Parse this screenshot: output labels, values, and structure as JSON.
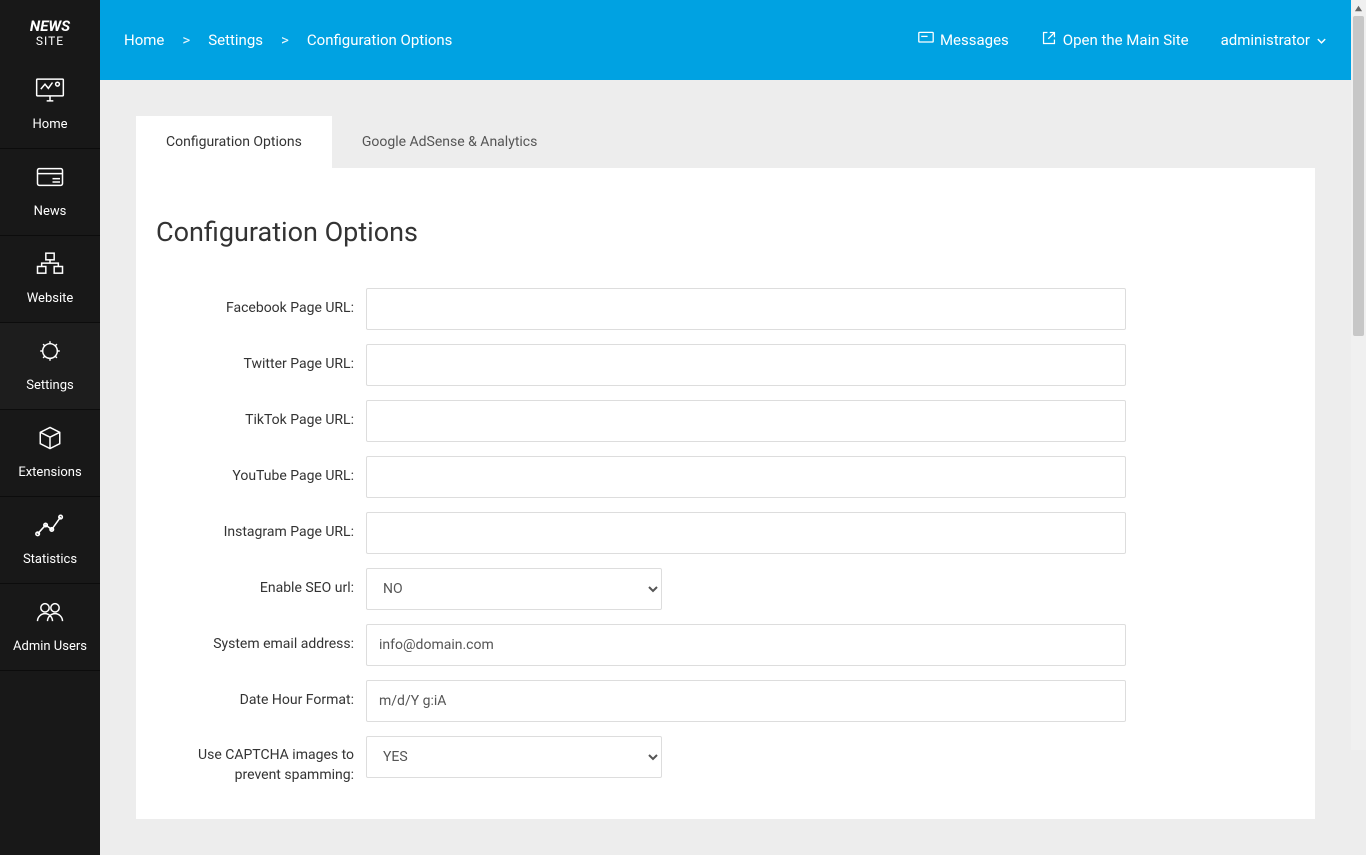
{
  "logo": {
    "line1": "NEWS",
    "line2": "SITE"
  },
  "sidebar": [
    {
      "label": "Home"
    },
    {
      "label": "News"
    },
    {
      "label": "Website"
    },
    {
      "label": "Settings"
    },
    {
      "label": "Extensions"
    },
    {
      "label": "Statistics"
    },
    {
      "label": "Admin Users"
    }
  ],
  "breadcrumbs": {
    "sep": ">",
    "items": [
      "Home",
      "Settings",
      "Configuration Options"
    ]
  },
  "topbar": {
    "messages": "Messages",
    "open_site": "Open the Main Site",
    "user": "administrator"
  },
  "tabs": [
    {
      "label": "Configuration Options",
      "active": true
    },
    {
      "label": "Google AdSense & Analytics",
      "active": false
    }
  ],
  "panel_title": "Configuration Options",
  "form": {
    "facebook": {
      "label": "Facebook Page URL:",
      "value": ""
    },
    "twitter": {
      "label": "Twitter Page URL:",
      "value": ""
    },
    "tiktok": {
      "label": "TikTok Page URL:",
      "value": ""
    },
    "youtube": {
      "label": "YouTube Page URL:",
      "value": ""
    },
    "instagram": {
      "label": "Instagram Page URL:",
      "value": ""
    },
    "seo": {
      "label": "Enable SEO url:",
      "value": "NO"
    },
    "email": {
      "label": "System email address:",
      "value": "info@domain.com"
    },
    "datefmt": {
      "label": "Date Hour Format:",
      "value": "m/d/Y g:iA"
    },
    "captcha": {
      "label": "Use CAPTCHA images to prevent spamming:",
      "value": "YES"
    }
  }
}
